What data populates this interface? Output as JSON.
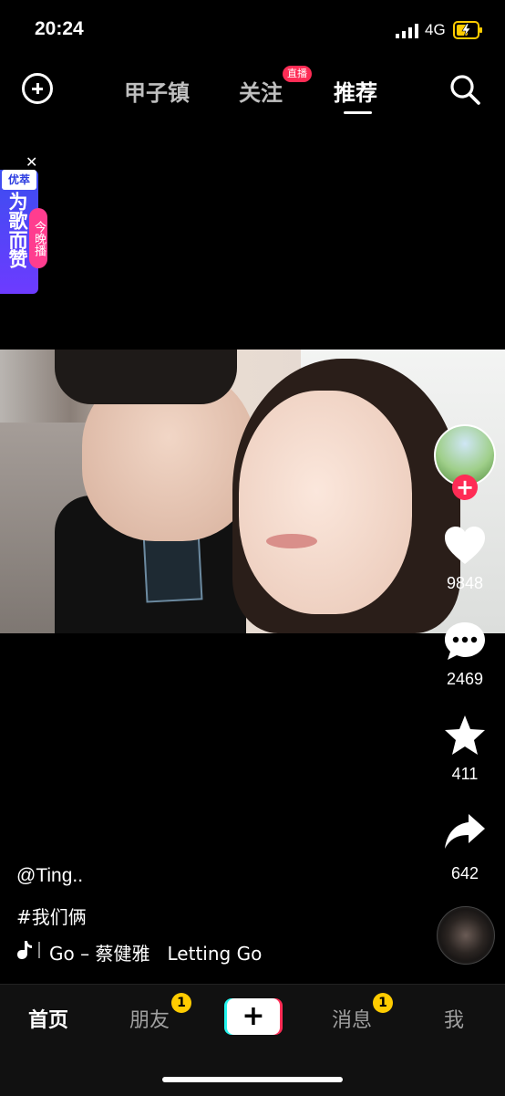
{
  "status_bar": {
    "time": "20:24",
    "network": "4G"
  },
  "top_nav": {
    "tabs": [
      {
        "label": "甲子镇"
      },
      {
        "label": "关注",
        "badge": "直播"
      },
      {
        "label": "推荐",
        "active": true
      }
    ]
  },
  "promo": {
    "tag": "优萃",
    "title": "为歌而赞",
    "subtitle": "今晚播"
  },
  "right_rail": {
    "likes": "9848",
    "comments": "2469",
    "favorites": "411",
    "shares": "642"
  },
  "caption": {
    "author": "@Ting..",
    "hashtag": "#我们俩",
    "music": "Go – 蔡健雅   Letting Go"
  },
  "bottom_nav": {
    "items": [
      {
        "label": "首页"
      },
      {
        "label": "朋友",
        "badge": "1"
      },
      {
        "label": "+"
      },
      {
        "label": "消息",
        "badge": "1"
      },
      {
        "label": "我"
      }
    ]
  },
  "colors": {
    "accent": "#fe2c55",
    "cyan": "#25f4ee",
    "badge": "#ffcc00",
    "promo": "#3b4ef0"
  }
}
